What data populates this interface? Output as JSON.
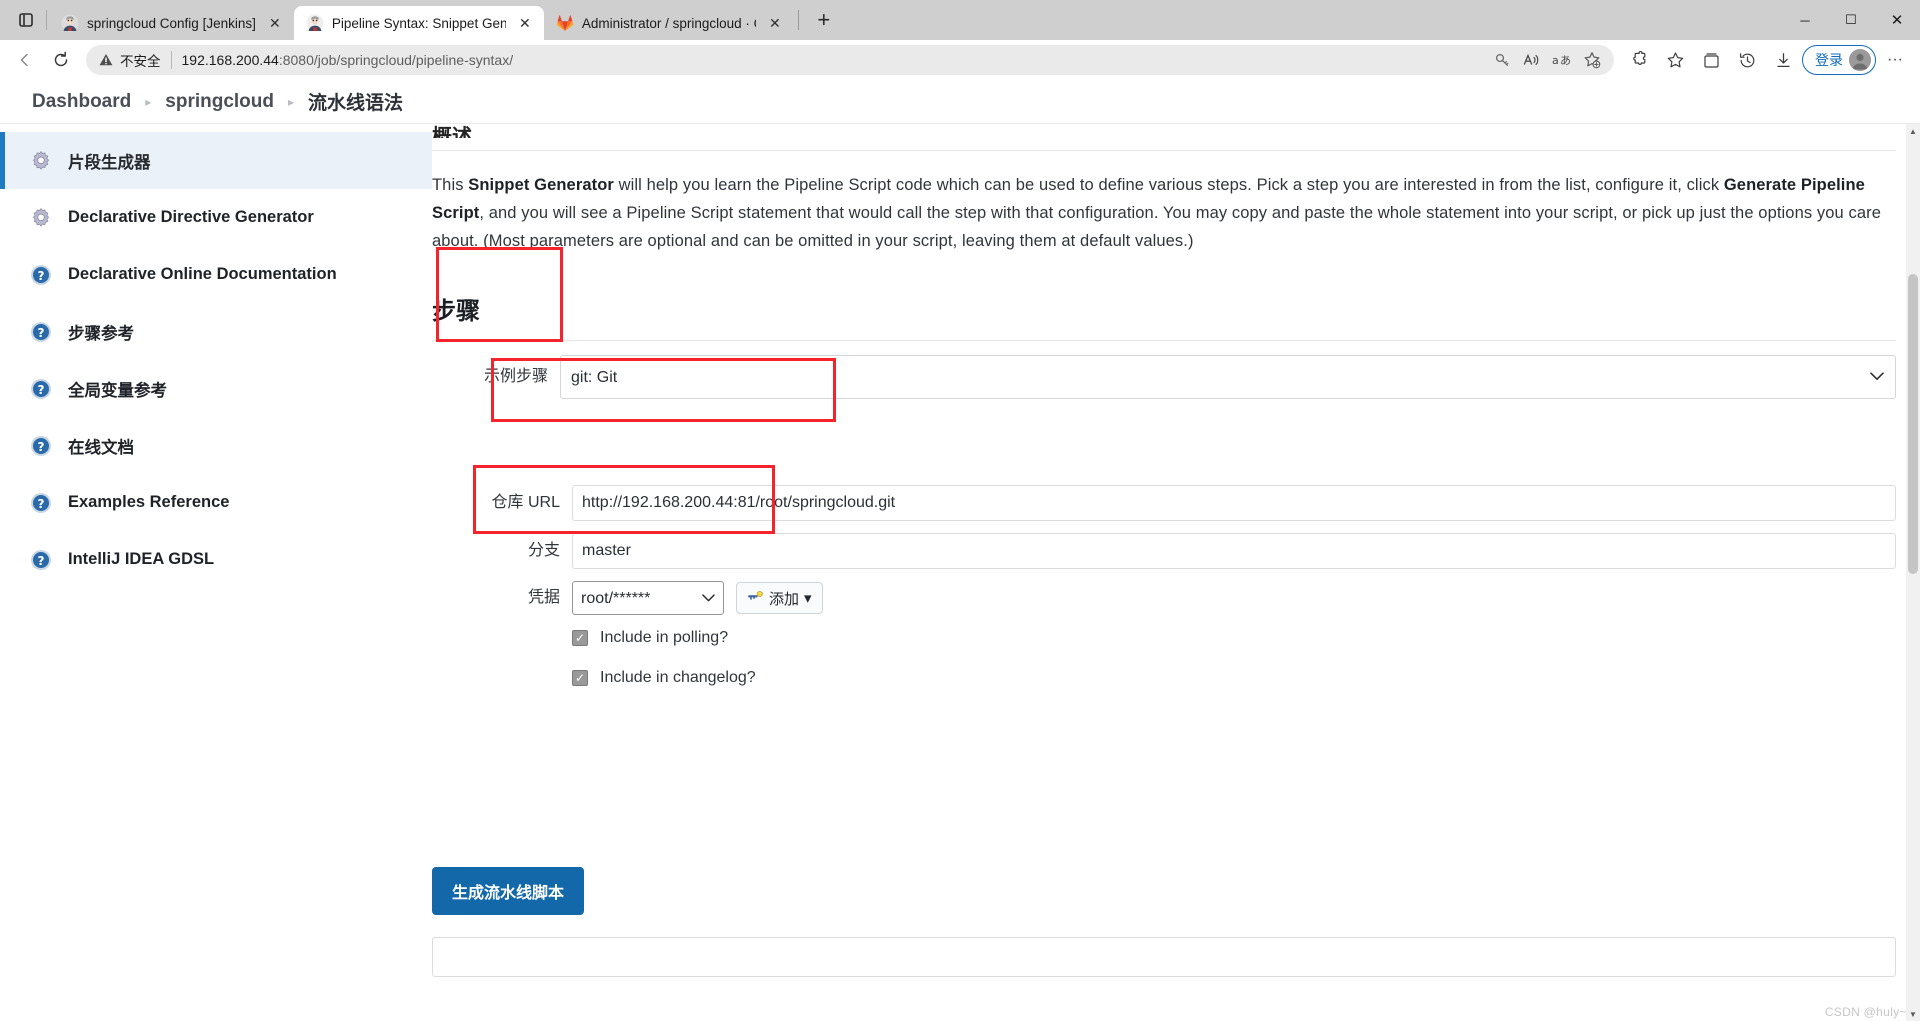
{
  "browser": {
    "tabs": [
      {
        "title": "springcloud Config [Jenkins]",
        "favicon": "jenkins-icon",
        "active": false,
        "close_label": "✕"
      },
      {
        "title": "Pipeline Syntax: Snippet Generat",
        "favicon": "jenkins-icon",
        "active": true,
        "close_label": "✕"
      },
      {
        "title": "Administrator / springcloud · GitL",
        "favicon": "gitlab-icon",
        "active": false,
        "close_label": "✕"
      }
    ],
    "new_tab_label": "+",
    "window_controls": {
      "minimize": "─",
      "maximize": "☐",
      "close": "✕"
    },
    "nav": {
      "back_label": "←",
      "reload_label": "↻",
      "security_text": "不安全",
      "url_host": "192.168.200.44",
      "url_path": ":8080/job/springcloud/pipeline-syntax/",
      "sign_in_label": "登录",
      "more_label": "···"
    }
  },
  "breadcrumb": {
    "items": [
      "Dashboard",
      "springcloud",
      "流水线语法"
    ],
    "separator": "▸"
  },
  "sidebar": {
    "items": [
      {
        "label": "片段生成器",
        "icon": "gear-icon",
        "active": true
      },
      {
        "label": "Declarative Directive Generator",
        "icon": "gear-icon",
        "active": false
      },
      {
        "label": "Declarative Online Documentation",
        "icon": "help-icon",
        "active": false
      },
      {
        "label": "步骤参考",
        "icon": "help-icon",
        "active": false
      },
      {
        "label": "全局变量参考",
        "icon": "help-icon",
        "active": false
      },
      {
        "label": "在线文档",
        "icon": "help-icon",
        "active": false
      },
      {
        "label": "Examples Reference",
        "icon": "help-icon",
        "active": false
      },
      {
        "label": "IntelliJ IDEA GDSL",
        "icon": "help-icon",
        "active": false
      }
    ]
  },
  "main": {
    "cut_heading": "概述",
    "intro_pre": "This ",
    "intro_b1": "Snippet Generator",
    "intro_mid1": " will help you learn the Pipeline Script code which can be used to define various steps. Pick a step you are interested in from the list, configure it, click ",
    "intro_b2": "Generate Pipeline Script",
    "intro_mid2": ", and you will see a Pipeline Script statement that would call the step with that configuration. You may copy and paste the whole statement into your script, or pick up just the options you care about. (Most parameters are optional and can be omitted in your script, leaving them at default values.)",
    "steps_heading": "步骤",
    "sample_step": {
      "label": "示例步骤",
      "value": "git: Git"
    },
    "fields": [
      {
        "name": "repo-url",
        "label": "仓库 URL",
        "value": "http://192.168.200.44:81/root/springcloud.git"
      },
      {
        "name": "branch",
        "label": "分支",
        "value": "master"
      }
    ],
    "credentials": {
      "label": "凭据",
      "value": "root/******",
      "add_button": "添加",
      "add_caret": "▾",
      "add_icon": "key-icon"
    },
    "checkboxes": [
      {
        "label": "Include in polling?",
        "checked": true
      },
      {
        "label": "Include in changelog?",
        "checked": true
      }
    ],
    "generate_button": "生成流水线脚本",
    "help_icon_label": "?"
  },
  "watermark": "CSDN @huly~~",
  "colors": {
    "accent": "#1268a8",
    "sidebar_active_bar": "#1f7bc1",
    "annotation": "#f5232b",
    "help": "#1a6aa2"
  }
}
